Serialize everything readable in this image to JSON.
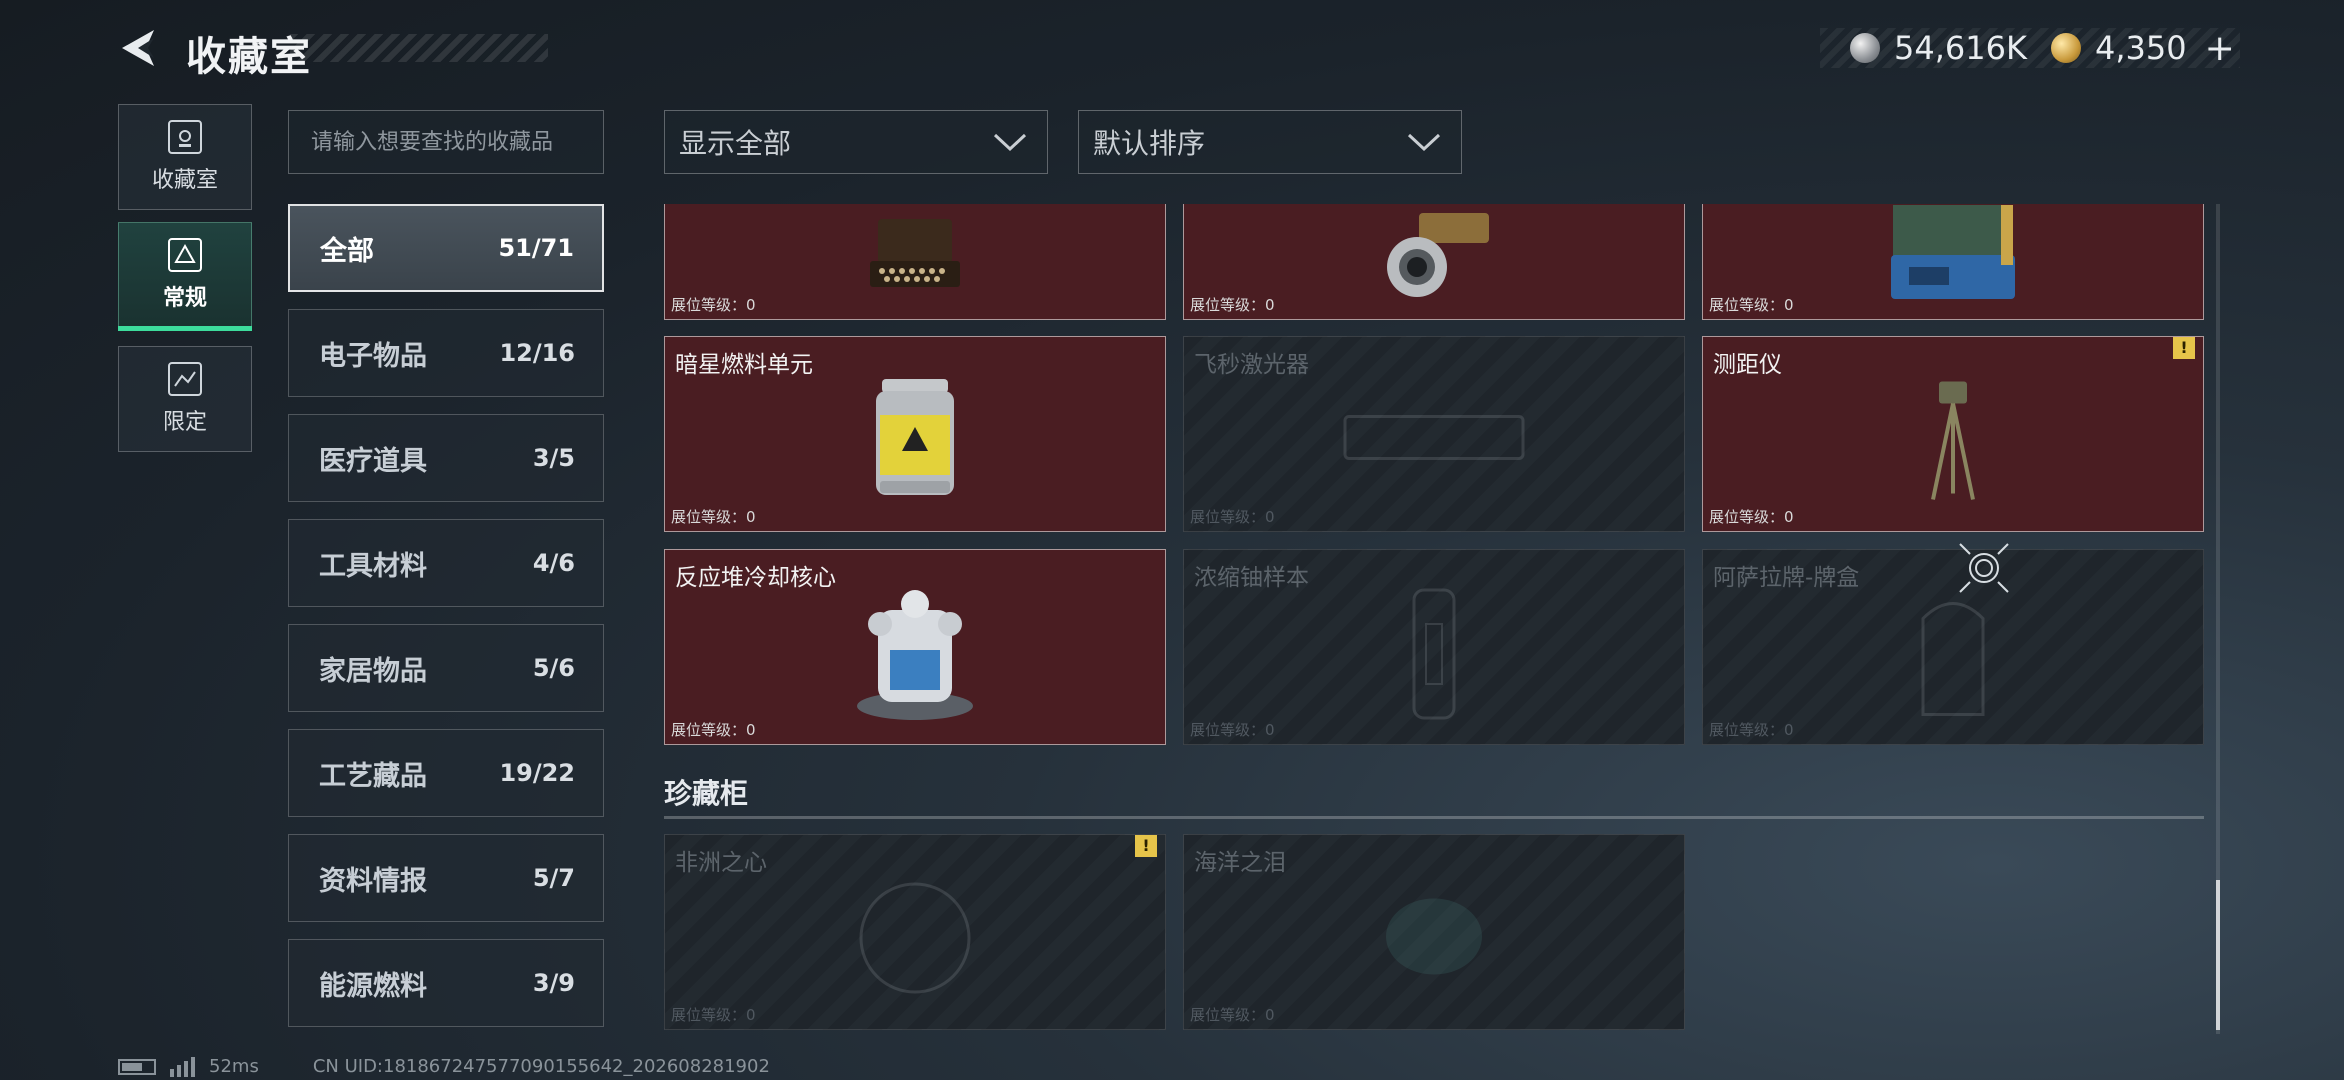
{
  "header": {
    "title": "收藏室",
    "currency_silver": "54,616K",
    "currency_gold": "4,350"
  },
  "rail": [
    {
      "label": "收藏室"
    },
    {
      "label": "常规"
    },
    {
      "label": "限定"
    }
  ],
  "search": {
    "placeholder": "请输入想要查找的收藏品"
  },
  "categories": [
    {
      "name": "全部",
      "count": "51/71"
    },
    {
      "name": "电子物品",
      "count": "12/16"
    },
    {
      "name": "医疗道具",
      "count": "3/5"
    },
    {
      "name": "工具材料",
      "count": "4/6"
    },
    {
      "name": "家居物品",
      "count": "5/6"
    },
    {
      "name": "工艺藏品",
      "count": "19/22"
    },
    {
      "name": "资料情报",
      "count": "5/7"
    },
    {
      "name": "能源燃料",
      "count": "3/9"
    }
  ],
  "filters": {
    "show": "显示全部",
    "sort": "默认排序"
  },
  "items": [
    {
      "name": "",
      "level": "展位等级：0"
    },
    {
      "name": "",
      "level": "展位等级：0"
    },
    {
      "name": "",
      "level": "展位等级：0"
    },
    {
      "name": "暗星燃料单元",
      "level": "展位等级：0"
    },
    {
      "name": "飞秒激光器",
      "level": "展位等级：0"
    },
    {
      "name": "测距仪",
      "level": "展位等级：0"
    },
    {
      "name": "反应堆冷却核心",
      "level": "展位等级：0"
    },
    {
      "name": "浓缩铀样本",
      "level": "展位等级：0"
    },
    {
      "name": "阿萨拉牌-牌盒",
      "level": "展位等级：0"
    }
  ],
  "treasure": {
    "title": "珍藏柜",
    "items": [
      {
        "name": "非洲之心",
        "level": "展位等级：0"
      },
      {
        "name": "海洋之泪",
        "level": "展位等级：0"
      }
    ]
  },
  "footer": {
    "ping": "52ms",
    "uid": "CN UID:181867247577090155642_202608281902"
  },
  "colors": {
    "owned_card": "#4a1d22",
    "accent_green": "#3ddc9c",
    "alert_badge": "#e6c44a"
  }
}
